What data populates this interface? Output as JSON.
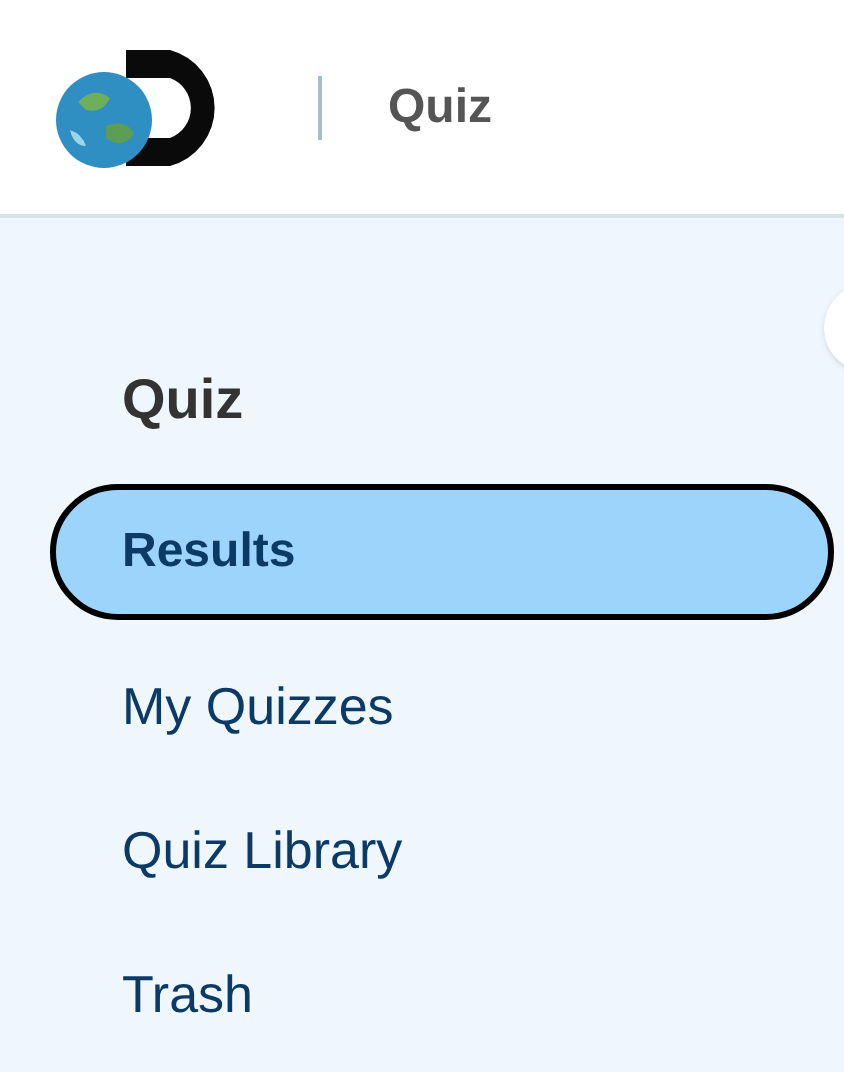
{
  "header": {
    "title": "Quiz"
  },
  "sidebar": {
    "heading": "Quiz",
    "items": [
      {
        "label": "Results",
        "selected": true
      },
      {
        "label": "My Quizzes",
        "selected": false
      },
      {
        "label": "Quiz Library",
        "selected": false
      },
      {
        "label": "Trash",
        "selected": false
      }
    ]
  }
}
